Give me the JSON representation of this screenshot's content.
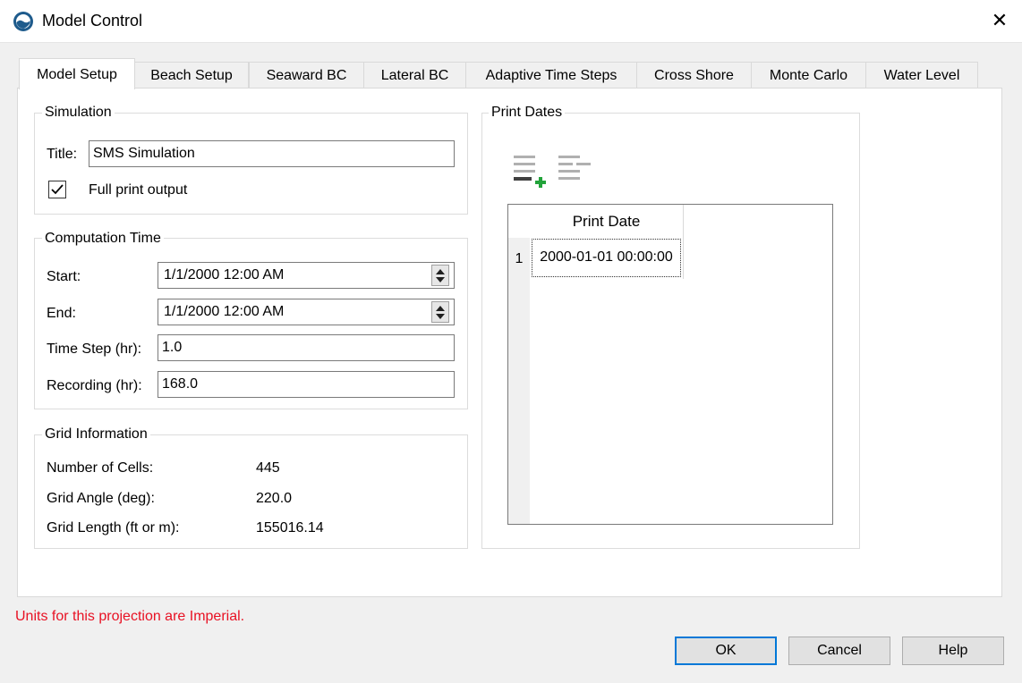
{
  "window": {
    "title": "Model Control",
    "close_glyph": "✕"
  },
  "tabs": [
    {
      "label": "Model Setup",
      "active": true
    },
    {
      "label": "Beach Setup"
    },
    {
      "label": "Seaward BC"
    },
    {
      "label": "Lateral BC"
    },
    {
      "label": "Adaptive Time Steps"
    },
    {
      "label": "Cross Shore"
    },
    {
      "label": "Monte Carlo"
    },
    {
      "label": "Water Level"
    }
  ],
  "simulation": {
    "group_title": "Simulation",
    "title_label": "Title:",
    "title_value": "SMS Simulation",
    "full_print_label": "Full print output",
    "full_print_checked": true
  },
  "computation": {
    "group_title": "Computation Time",
    "start_label": "Start:",
    "start_value": "1/1/2000 12:00 AM",
    "end_label": "End:",
    "end_value": "1/1/2000 12:00 AM",
    "timestep_label": "Time Step (hr):",
    "timestep_value": "1.0",
    "recording_label": "Recording (hr):",
    "recording_value": "168.0"
  },
  "grid": {
    "group_title": "Grid Information",
    "cells_label": "Number of Cells:",
    "cells_value": "445",
    "angle_label": "Grid Angle (deg):",
    "angle_value": "220.0",
    "length_label": "Grid Length (ft or m):",
    "length_value": "155016.14"
  },
  "print_dates": {
    "group_title": "Print Dates",
    "column_header": "Print Date",
    "rows": [
      {
        "index": "1",
        "value": "2000-01-01 00:00:00"
      }
    ],
    "icons": [
      "add-row-icon",
      "remove-row-icon"
    ]
  },
  "status": {
    "units_message": "Units for this projection are Imperial.",
    "color": "#e81123"
  },
  "buttons": {
    "ok": "OK",
    "cancel": "Cancel",
    "help": "Help"
  },
  "colors": {
    "accent": "#0078d7",
    "add_green": "#22a33a"
  }
}
